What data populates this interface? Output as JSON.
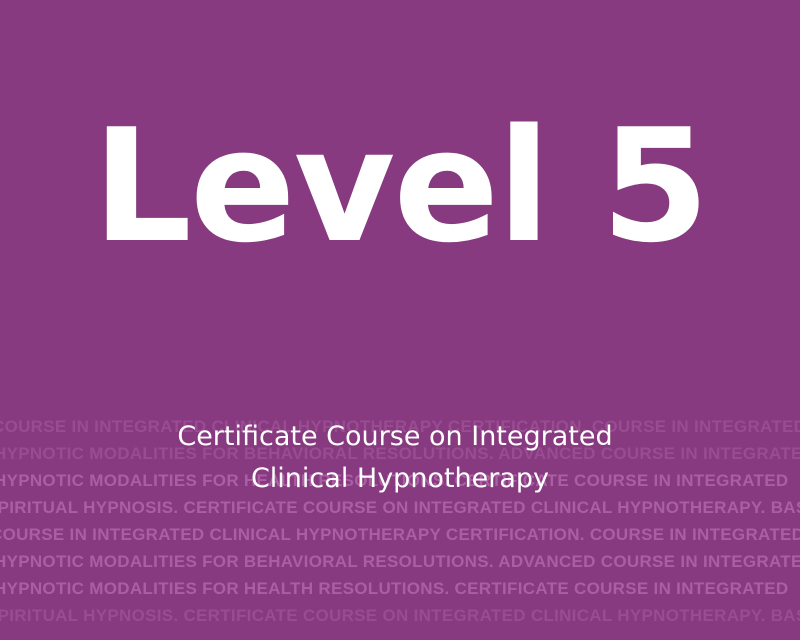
{
  "colors": {
    "background": "#873a7f",
    "text": "#ffffff",
    "background_text": "#ab5fa3"
  },
  "headline": "Level 5",
  "subtitle": {
    "line1": "Certificate Course on Integrated",
    "line2": "Clinical Hypnotherapy"
  },
  "background_text": [
    "COURSE IN INTEGRATED CLINICAL HYPNOTHERAPY CERTIFICATION. COURSE IN INTEGRATED",
    "HYPNOTIC MODALITIES FOR BEHAVIORAL RESOLUTIONS.  ADVANCED COURSE IN INTEGRATED",
    "HYPNOTIC MODALITIES FOR HEALTH RESOLUTIONS.  CERTIFICATE COURSE IN INTEGRATED",
    "SPIRITUAL HYPNOSIS. CERTIFICATE COURSE ON INTEGRATED CLINICAL HYPNOTHERAPY. BASIC",
    "COURSE IN INTEGRATED CLINICAL HYPNOTHERAPY CERTIFICATION. COURSE IN INTEGRATED",
    "HYPNOTIC MODALITIES FOR BEHAVIORAL RESOLUTIONS.  ADVANCED COURSE IN INTEGRATED",
    "HYPNOTIC MODALITIES FOR HEALTH RESOLUTIONS.  CERTIFICATE COURSE IN INTEGRATED",
    "SPIRITUAL HYPNOSIS. CERTIFICATE COURSE ON INTEGRATED CLINICAL HYPNOTHERAPY. BASIC"
  ]
}
